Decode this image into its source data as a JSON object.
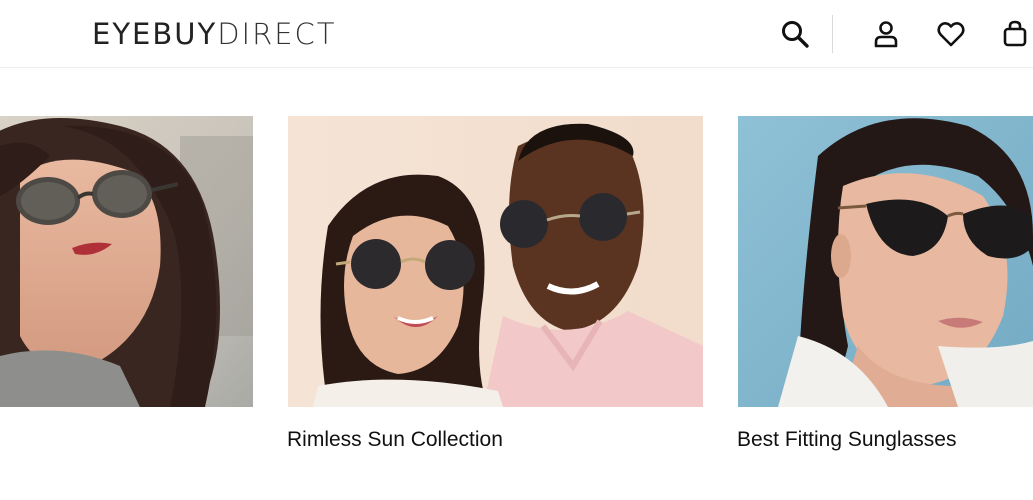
{
  "header": {
    "logo_bold": "EYEBUY",
    "logo_light": "DIRECT"
  },
  "cards": [
    {
      "title": ""
    },
    {
      "title": "Rimless Sun Collection"
    },
    {
      "title": "Best Fitting Sunglasses"
    }
  ],
  "icons": {
    "search": "search-icon",
    "account": "account-icon",
    "wishlist": "heart-icon",
    "cart": "bag-icon"
  }
}
